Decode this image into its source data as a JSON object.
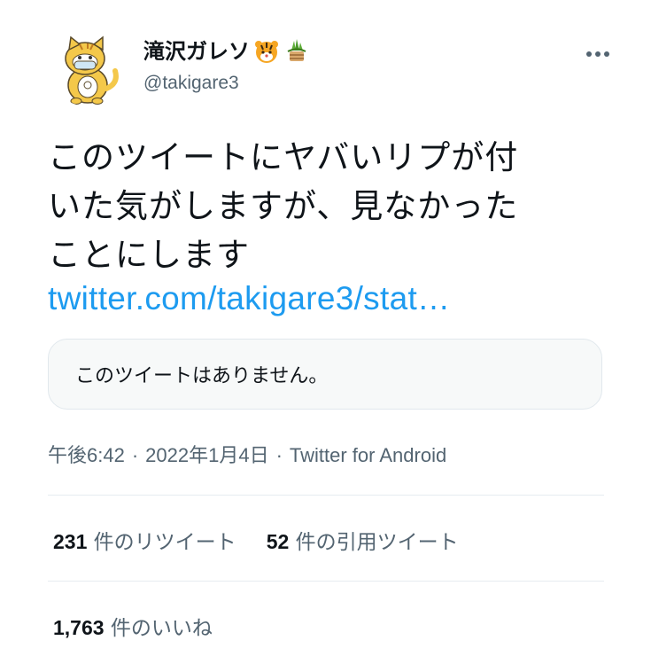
{
  "author": {
    "display_name": "滝沢ガレソ",
    "handle": "@takigare3",
    "emoji": [
      "tiger-face-emoji",
      "kadomatsu-emoji"
    ]
  },
  "tweet": {
    "text_lines": [
      "このツイートにヤバいリプが付",
      "いた気がしますが、見なかった",
      "ことにします"
    ],
    "link": "twitter.com/takigare3/stat…",
    "quoted_unavailable": "このツイートはありません。"
  },
  "meta": {
    "time": "午後6:42",
    "date": "2022年1月4日",
    "source": "Twitter for Android",
    "separator": "·"
  },
  "stats": {
    "retweets_count": "231",
    "retweets_label": " 件のリツイート",
    "quotes_count": "52",
    "quotes_label": " 件の引用ツイート",
    "likes_count": "1,763",
    "likes_label": " 件のいいね"
  },
  "colors": {
    "link": "#1d9bf0",
    "secondary_text": "#536471",
    "text": "#0f1419"
  }
}
